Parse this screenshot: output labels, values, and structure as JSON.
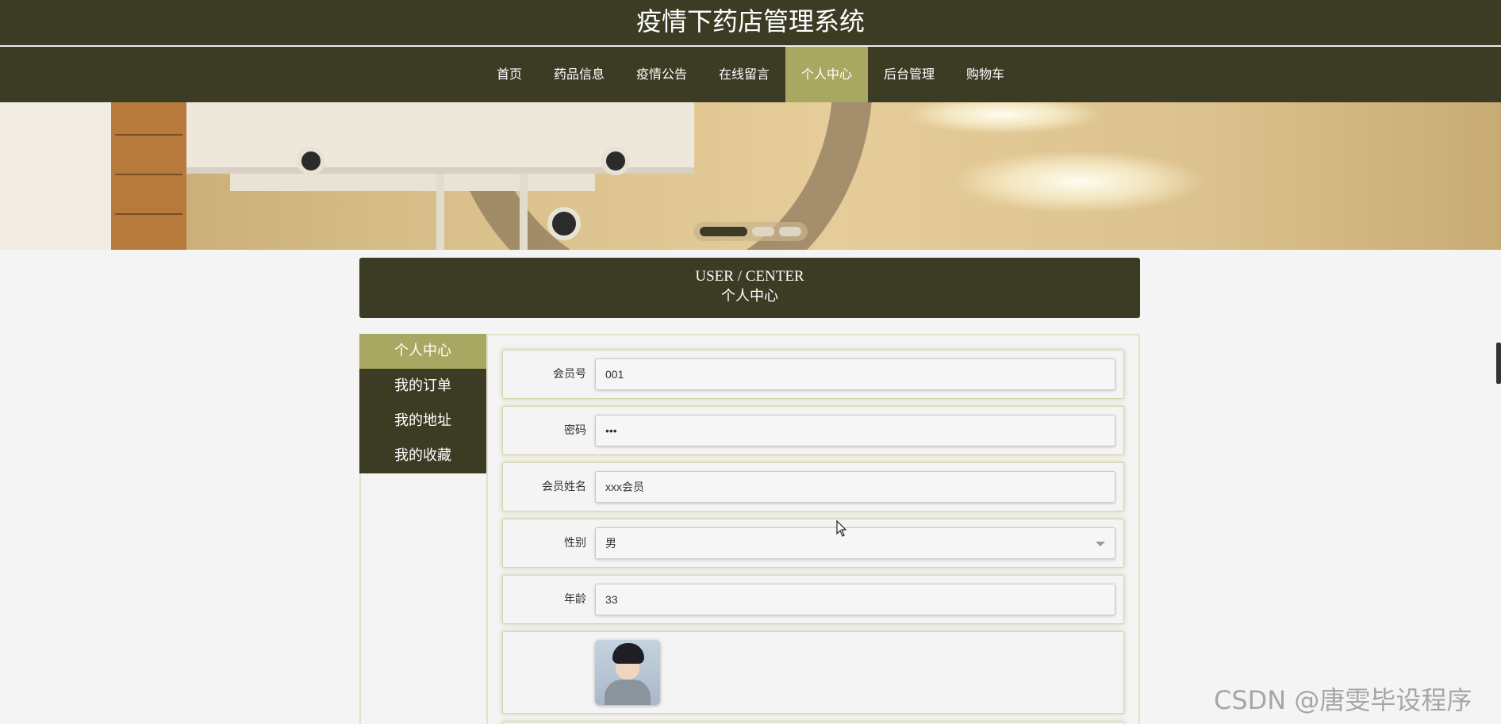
{
  "header": {
    "title": "疫情下药店管理系统"
  },
  "nav": {
    "items": [
      {
        "label": "首页",
        "active": false
      },
      {
        "label": "药品信息",
        "active": false
      },
      {
        "label": "疫情公告",
        "active": false
      },
      {
        "label": "在线留言",
        "active": false
      },
      {
        "label": "个人中心",
        "active": true
      },
      {
        "label": "后台管理",
        "active": false
      },
      {
        "label": "购物车",
        "active": false
      }
    ]
  },
  "banner": {
    "slide_count": 3,
    "active_slide": 1
  },
  "section": {
    "title_en": "USER / CENTER",
    "title_cn": "个人中心"
  },
  "sidebar": {
    "items": [
      {
        "label": "个人中心",
        "active": true
      },
      {
        "label": "我的订单",
        "active": false
      },
      {
        "label": "我的地址",
        "active": false
      },
      {
        "label": "我的收藏",
        "active": false
      }
    ]
  },
  "form": {
    "member_no": {
      "label": "会员号",
      "value": "001"
    },
    "password": {
      "label": "密码",
      "value": "•••"
    },
    "member_name": {
      "label": "会员姓名",
      "value": "xxx会员"
    },
    "gender": {
      "label": "性别",
      "value": "男"
    },
    "age": {
      "label": "年龄",
      "value": "33"
    }
  },
  "watermark": "CSDN @唐雯毕设程序",
  "colors": {
    "primary": "#3c3c25",
    "accent": "#a9a862",
    "background": "#f4f4f4"
  }
}
